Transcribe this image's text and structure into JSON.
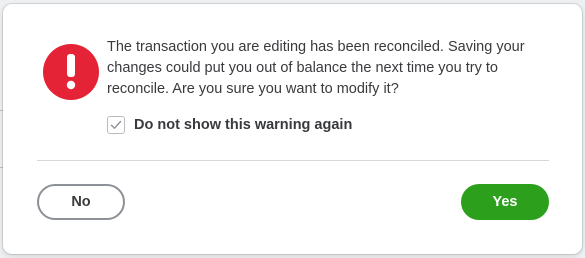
{
  "dialog": {
    "message": "The transaction you are editing has been reconciled. Saving your changes could put you out of balance the next time you try to reconcile. Are you sure you want to modify it?",
    "icon": "exclamation-alert-icon",
    "checkbox": {
      "label": "Do not show this warning again",
      "checked": true
    },
    "buttons": {
      "no_label": "No",
      "yes_label": "Yes"
    }
  },
  "colors": {
    "alert_red": "#e42436",
    "confirm_green": "#2ca01c",
    "text": "#393a3d"
  }
}
